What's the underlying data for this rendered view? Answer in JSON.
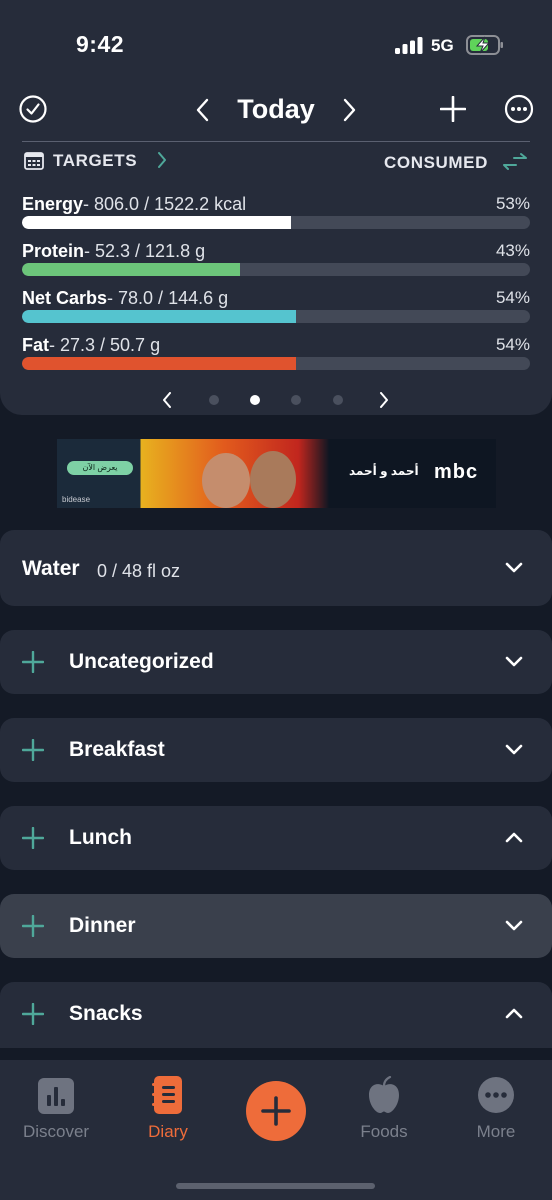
{
  "status_bar": {
    "time": "9:42",
    "network": "5G"
  },
  "header": {
    "title": "Today"
  },
  "targets": {
    "label": "TARGETS",
    "mode": "CONSUMED"
  },
  "macros": [
    {
      "name": "Energy",
      "values": "- 806.0 / 1522.2 kcal",
      "percent": "53%",
      "fill": 0.53,
      "color": "#ffffff"
    },
    {
      "name": "Protein",
      "values": "- 52.3 / 121.8 g",
      "percent": "43%",
      "fill": 0.43,
      "color": "#6cc57a"
    },
    {
      "name": "Net Carbs",
      "values": "- 78.0 / 144.6 g",
      "percent": "54%",
      "fill": 0.54,
      "color": "#55c4cf"
    },
    {
      "name": "Fat",
      "values": "- 27.3 / 50.7 g",
      "percent": "54%",
      "fill": 0.54,
      "color": "#e0532e"
    }
  ],
  "ad": {
    "tag": "bidease",
    "brand": "mbc",
    "button": "يعرض الآن",
    "headline": "أحمد و أحمد"
  },
  "water": {
    "label": "Water",
    "value": "0 / 48 fl oz"
  },
  "meals": [
    {
      "label": "Uncategorized",
      "expanded": false
    },
    {
      "label": "Breakfast",
      "expanded": false
    },
    {
      "label": "Lunch",
      "expanded": true
    },
    {
      "label": "Dinner",
      "expanded": false
    },
    {
      "label": "Snacks",
      "expanded": true
    }
  ],
  "tabs": [
    {
      "label": "Discover",
      "icon": "bar-chart-icon",
      "active": false
    },
    {
      "label": "Diary",
      "icon": "diary-icon",
      "active": true
    },
    {
      "label": "Foods",
      "icon": "apple-icon",
      "active": false
    },
    {
      "label": "More",
      "icon": "more-dots-icon",
      "active": false
    }
  ],
  "colors": {
    "accent": "#ee6c3a",
    "teal": "#4fa89a",
    "background": "#141a26",
    "card": "#262c3a"
  }
}
